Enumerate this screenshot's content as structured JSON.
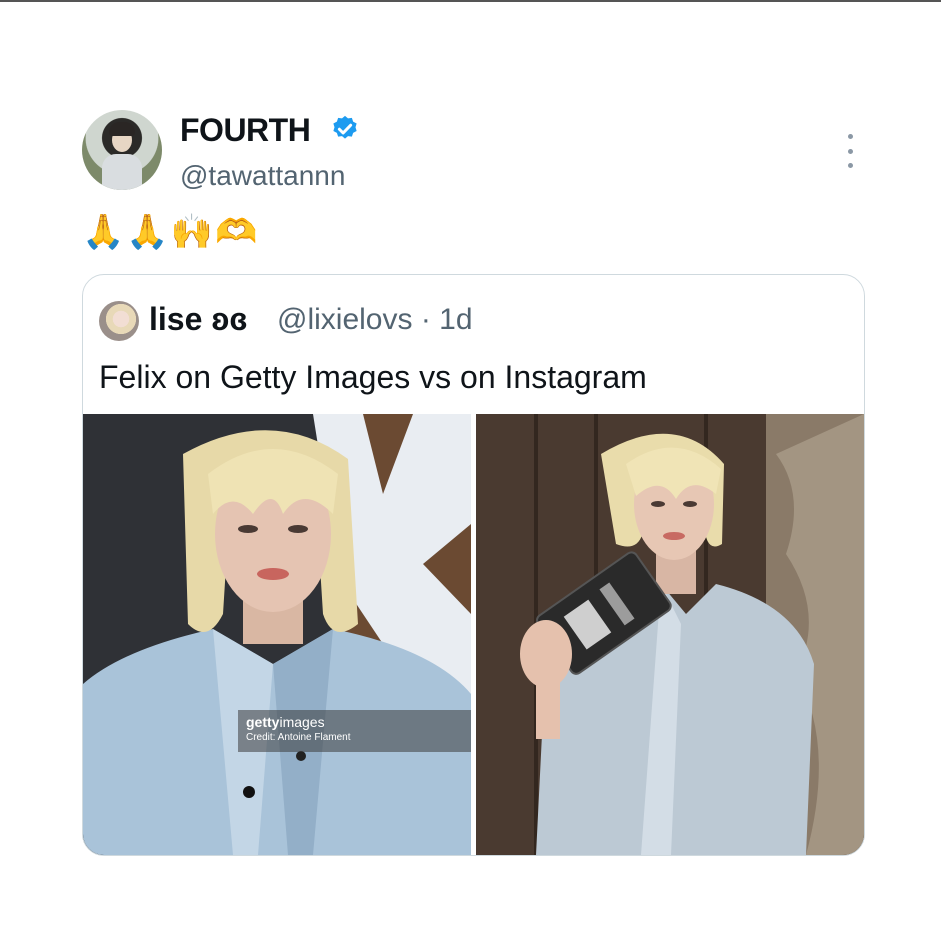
{
  "tweet": {
    "display_name": "FOURTH",
    "handle": "@tawattannn",
    "verified": true,
    "text": "🙏🙏🙌🫶",
    "more_icon": "more-horizontal-icon"
  },
  "quoted_tweet": {
    "display_name": "lise ʚɞ",
    "handle_meta": "@lixielovs · 1d",
    "text": "Felix on Getty Images vs on Instagram",
    "credit_brand": "getty",
    "credit_brand_suffix": "images",
    "credit_line": "Credit: Antoine Flament"
  },
  "colors": {
    "verified_blue": "#1d9bf0",
    "secondary_text": "#536471",
    "border": "#cfd9de"
  }
}
